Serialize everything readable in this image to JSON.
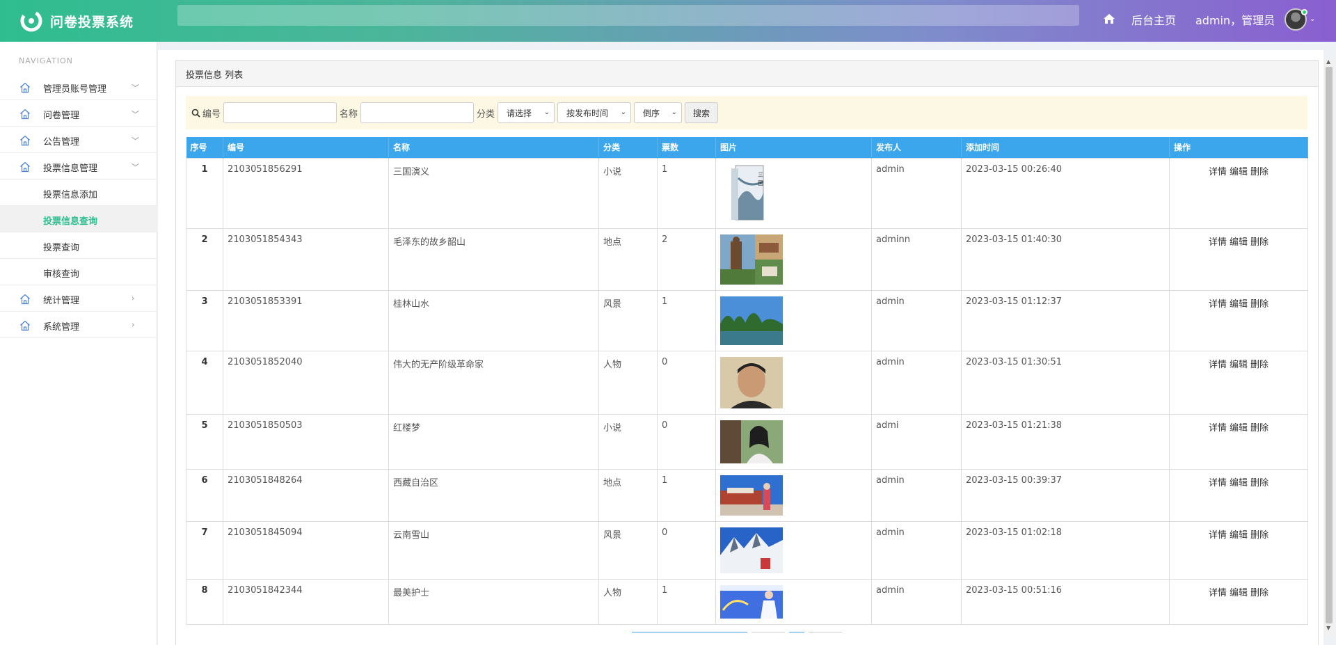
{
  "header": {
    "brand_title": "问卷投票系统",
    "home_label": "后台主页",
    "user_text": "admin，管理员"
  },
  "sidebar": {
    "heading": "NAVIGATION",
    "items": [
      {
        "label": "管理员账号管理",
        "arrow": "﹀"
      },
      {
        "label": "问卷管理",
        "arrow": "﹀"
      },
      {
        "label": "公告管理",
        "arrow": "﹀"
      },
      {
        "label": "投票信息管理",
        "arrow": "﹀"
      }
    ],
    "subitems": [
      {
        "label": "投票信息添加"
      },
      {
        "label": "投票信息查询"
      },
      {
        "label": "投票查询"
      },
      {
        "label": "审核查询"
      }
    ],
    "items_after": [
      {
        "label": "统计管理",
        "arrow": "›"
      },
      {
        "label": "系统管理",
        "arrow": "›"
      }
    ]
  },
  "panel": {
    "title": "投票信息 列表"
  },
  "search": {
    "code_label": "编号",
    "name_label": "名称",
    "category_label": "分类",
    "category_select": "请选择",
    "sort_select": "按发布时间",
    "order_select": "倒序",
    "search_button": "搜索"
  },
  "table": {
    "headers": [
      "序号",
      "编号",
      "名称",
      "分类",
      "票数",
      "图片",
      "发布人",
      "添加时间",
      "操作"
    ],
    "ops": {
      "detail": "详情",
      "edit": "编辑",
      "delete": "删除"
    },
    "rows": [
      {
        "idx": "1",
        "code": "2103051856291",
        "name": "三国演义",
        "category": "小说",
        "votes": "1",
        "publisher": "admin",
        "time": "2023-03-15 00:26:40"
      },
      {
        "idx": "2",
        "code": "2103051854343",
        "name": "毛泽东的故乡韶山",
        "category": "地点",
        "votes": "2",
        "publisher": "adminn",
        "time": "2023-03-15 01:40:30"
      },
      {
        "idx": "3",
        "code": "2103051853391",
        "name": "桂林山水",
        "category": "风景",
        "votes": "1",
        "publisher": "admin",
        "time": "2023-03-15 01:12:37"
      },
      {
        "idx": "4",
        "code": "2103051852040",
        "name": "伟大的无产阶级革命家",
        "category": "人物",
        "votes": "0",
        "publisher": "admin",
        "time": "2023-03-15 01:30:51"
      },
      {
        "idx": "5",
        "code": "2103051850503",
        "name": "红楼梦",
        "category": "小说",
        "votes": "0",
        "publisher": "admi",
        "time": "2023-03-15 01:21:38"
      },
      {
        "idx": "6",
        "code": "2103051848264",
        "name": "西藏自治区",
        "category": "地点",
        "votes": "1",
        "publisher": "admin",
        "time": "2023-03-15 00:39:37"
      },
      {
        "idx": "7",
        "code": "2103051845094",
        "name": "云南雪山",
        "category": "风景",
        "votes": "0",
        "publisher": "admin",
        "time": "2023-03-15 01:02:18"
      },
      {
        "idx": "8",
        "code": "2103051842344",
        "name": "最美护士",
        "category": "人物",
        "votes": "1",
        "publisher": "admin",
        "time": "2023-03-15 00:51:16"
      }
    ]
  },
  "colors": {
    "accent_green": "#2fbd8f",
    "table_header_blue": "#3ca6ec",
    "search_bar_bg": "#fcf8e3"
  }
}
